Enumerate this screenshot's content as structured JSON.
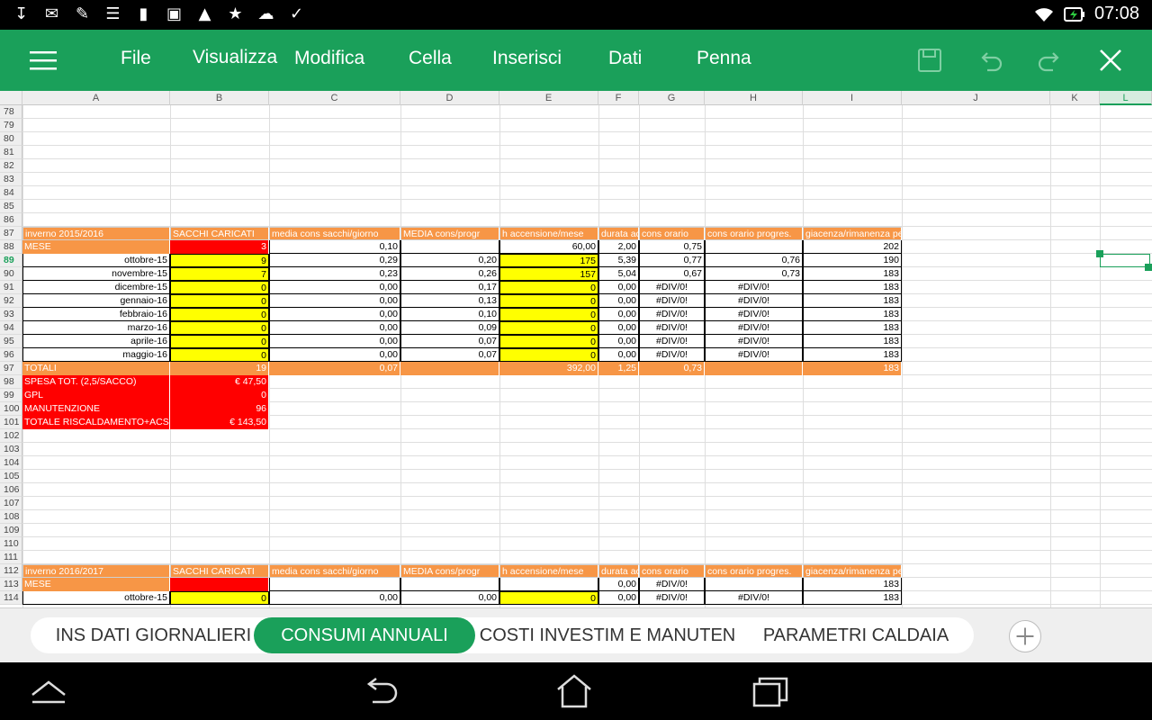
{
  "status_bar": {
    "notification_icons": [
      "download-icon",
      "mail-icon",
      "chat-icon",
      "clipboard-icon",
      "sd-card-icon",
      "photo-icon",
      "image-icon",
      "game-icon",
      "cloud-upload-icon",
      "checklist-icon"
    ],
    "clock": "07:08"
  },
  "toolbar": {
    "menu": [
      "File",
      "Visualizza",
      "Modifica",
      "Cella",
      "Inserisci",
      "Dati",
      "Penna"
    ],
    "accent": "#1aa05a"
  },
  "columns": [
    "A",
    "B",
    "C",
    "D",
    "E",
    "F",
    "G",
    "H",
    "I",
    "J",
    "K",
    "L"
  ],
  "selected_cell": "L89",
  "rows": [
    "78",
    "79",
    "80",
    "81",
    "82",
    "83",
    "84",
    "85",
    "86",
    "87",
    "88",
    "89",
    "90",
    "91",
    "92",
    "93",
    "94",
    "95",
    "96",
    "97",
    "98",
    "99",
    "100",
    "101",
    "102",
    "103",
    "104",
    "105",
    "106",
    "107",
    "108",
    "109",
    "110",
    "111",
    "112",
    "113",
    "114"
  ],
  "table1": {
    "header": [
      "inverno 2015/2016",
      "SACCHI CARICATI",
      "media cons sacchi/giorno",
      "MEDIA cons/progr",
      "h accensione/mese",
      "durata acc.media/gg",
      "cons orario",
      "cons orario progres.",
      "giacenza/rimanenza pellet"
    ],
    "mese_row": [
      "MESE",
      "3",
      "0,10",
      "",
      "60,00",
      "2,00",
      "0,75",
      "",
      "202"
    ],
    "months": [
      [
        "ottobre-15",
        "9",
        "0,29",
        "0,20",
        "175",
        "5,39",
        "0,77",
        "0,76",
        "190"
      ],
      [
        "novembre-15",
        "7",
        "0,23",
        "0,26",
        "157",
        "5,04",
        "0,67",
        "0,73",
        "183"
      ],
      [
        "dicembre-15",
        "0",
        "0,00",
        "0,17",
        "0",
        "0,00",
        "#DIV/0!",
        "#DIV/0!",
        "183"
      ],
      [
        "gennaio-16",
        "0",
        "0,00",
        "0,13",
        "0",
        "0,00",
        "#DIV/0!",
        "#DIV/0!",
        "183"
      ],
      [
        "febbraio-16",
        "0",
        "0,00",
        "0,10",
        "0",
        "0,00",
        "#DIV/0!",
        "#DIV/0!",
        "183"
      ],
      [
        "marzo-16",
        "0",
        "0,00",
        "0,09",
        "0",
        "0,00",
        "#DIV/0!",
        "#DIV/0!",
        "183"
      ],
      [
        "aprile-16",
        "0",
        "0,00",
        "0,07",
        "0",
        "0,00",
        "#DIV/0!",
        "#DIV/0!",
        "183"
      ],
      [
        "maggio-16",
        "0",
        "0,00",
        "0,07",
        "0",
        "0,00",
        "#DIV/0!",
        "#DIV/0!",
        "183"
      ]
    ],
    "totals": [
      "TOTALI",
      "19",
      "0,07",
      "",
      "392,00",
      "1,25",
      "0,73",
      "",
      "183"
    ],
    "costs": [
      [
        "SPESA TOT. (2,5/SACCO)",
        "€ 47,50"
      ],
      [
        "GPL",
        "0"
      ],
      [
        "MANUTENZIONE",
        "96"
      ],
      [
        "TOTALE RISCALDAMENTO+ACS",
        "€ 143,50"
      ]
    ]
  },
  "table2": {
    "header": [
      "inverno 2016/2017",
      "SACCHI CARICATI",
      "media cons sacchi/giorno",
      "MEDIA cons/progr",
      "h accensione/mese",
      "durata acc.media/gg",
      "cons orario",
      "cons orario progres.",
      "giacenza/rimanenza pellet"
    ],
    "mese_row": [
      "MESE",
      "",
      "",
      "",
      "",
      "0,00",
      "#DIV/0!",
      "",
      "183"
    ],
    "first_month": [
      "ottobre-15",
      "0",
      "0,00",
      "0,00",
      "0",
      "0,00",
      "#DIV/0!",
      "#DIV/0!",
      "183"
    ]
  },
  "sheet_tabs": [
    "INS DATI GIORNALIERI",
    "CONSUMI ANNUALI",
    "COSTI INVESTIM E MANUTEN",
    "PARAMETRI CALDAIA"
  ],
  "active_tab": "CONSUMI ANNUALI"
}
